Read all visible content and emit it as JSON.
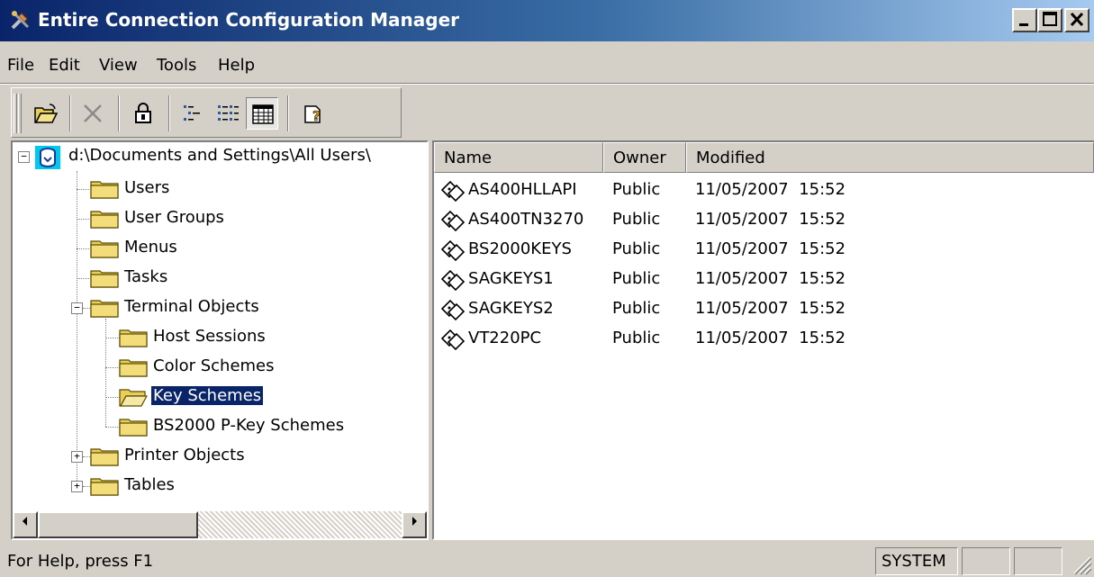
{
  "window": {
    "title": "Entire Connection Configuration Manager",
    "icon": "tools-icon",
    "controls": [
      "minimize",
      "maximize",
      "close"
    ]
  },
  "menu": [
    "File",
    "Edit",
    "View",
    "Tools",
    "Help"
  ],
  "toolbar": {
    "buttons": [
      {
        "name": "open-folder",
        "icon": "open-folder-icon"
      },
      {
        "name": "delete",
        "icon": "delete-x-icon",
        "disabled": true
      },
      {
        "name": "lock",
        "icon": "lock-icon"
      },
      {
        "name": "list-view",
        "icon": "list-view-icon"
      },
      {
        "name": "tree-view",
        "icon": "tree-view-icon"
      },
      {
        "name": "details-view",
        "icon": "details-view-icon",
        "pressed": true
      },
      {
        "name": "help",
        "icon": "help-icon"
      }
    ]
  },
  "tree": {
    "root": "d:\\Documents and Settings\\All Users\\",
    "items": [
      {
        "label": "Users",
        "level": 1,
        "expander": ""
      },
      {
        "label": "User Groups",
        "level": 1,
        "expander": ""
      },
      {
        "label": "Menus",
        "level": 1,
        "expander": ""
      },
      {
        "label": "Tasks",
        "level": 1,
        "expander": ""
      },
      {
        "label": "Terminal Objects",
        "level": 1,
        "expander": "−"
      },
      {
        "label": "Host Sessions",
        "level": 2,
        "expander": ""
      },
      {
        "label": "Color Schemes",
        "level": 2,
        "expander": ""
      },
      {
        "label": "Key Schemes",
        "level": 2,
        "expander": "",
        "selected": true,
        "open": true
      },
      {
        "label": "BS2000 P-Key Schemes",
        "level": 2,
        "expander": ""
      },
      {
        "label": "Printer Objects",
        "level": 1,
        "expander": "+"
      },
      {
        "label": "Tables",
        "level": 1,
        "expander": "+"
      }
    ]
  },
  "list": {
    "columns": [
      "Name",
      "Owner",
      "Modified"
    ],
    "rows": [
      {
        "name": "AS400HLLAPI",
        "owner": "Public",
        "modified": "11/05/2007  15:52"
      },
      {
        "name": "AS400TN3270",
        "owner": "Public",
        "modified": "11/05/2007  15:52"
      },
      {
        "name": "BS2000KEYS",
        "owner": "Public",
        "modified": "11/05/2007  15:52"
      },
      {
        "name": "SAGKEYS1",
        "owner": "Public",
        "modified": "11/05/2007  15:52"
      },
      {
        "name": "SAGKEYS2",
        "owner": "Public",
        "modified": "11/05/2007  15:52"
      },
      {
        "name": "VT220PC",
        "owner": "Public",
        "modified": "11/05/2007  15:52"
      }
    ]
  },
  "status": {
    "help": "For Help, press F1",
    "user": "SYSTEM",
    "panel2": "",
    "panel3": ""
  },
  "colors": {
    "titlebar_start": "#0a246a",
    "titlebar_end": "#a6caf0",
    "face": "#d4d0c8",
    "selection": "#0a246a",
    "folder": "#e8cf5b"
  }
}
